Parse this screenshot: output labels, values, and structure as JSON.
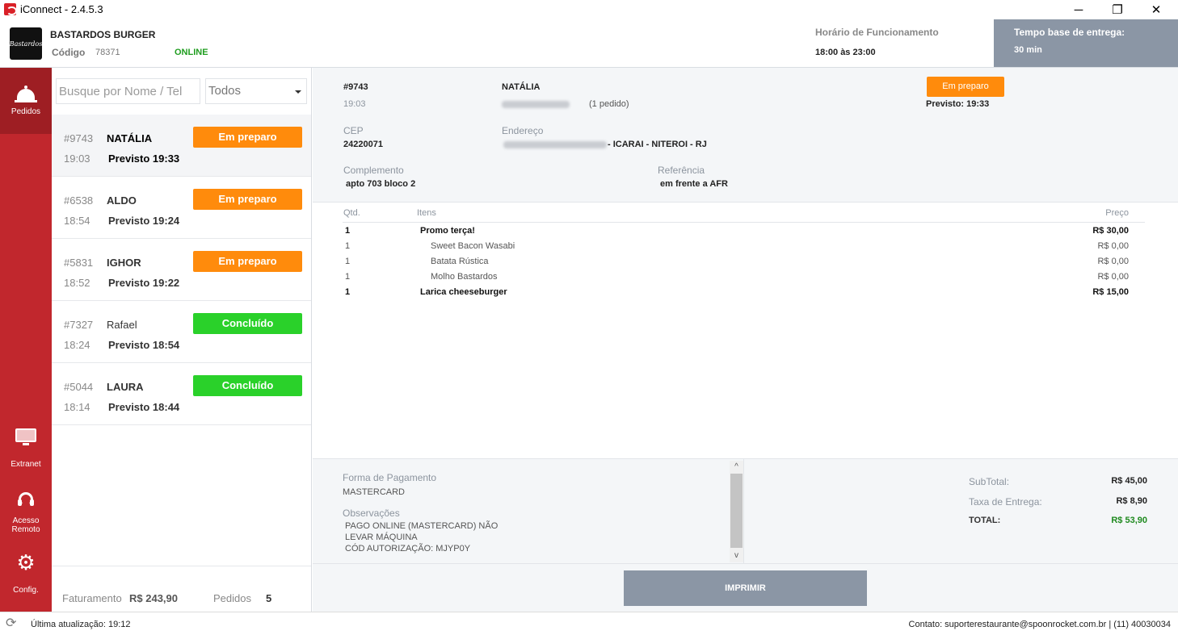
{
  "window": {
    "title": "iConnect - 2.4.5.3",
    "minimize_glyph": "─",
    "maximize_glyph": "❐",
    "close_glyph": "✕"
  },
  "header": {
    "store_name": "BASTARDOS BURGER",
    "code_label": "Código",
    "code_value": "78371",
    "status": "ONLINE",
    "hours_label": "Horário de Funcionamento",
    "hours_value": "18:00 às 23:00",
    "delivery_label": "Tempo base de entrega:",
    "delivery_value": "30 min"
  },
  "sidebar": {
    "items": [
      {
        "label": "Pedidos",
        "icon": "bell-icon"
      },
      {
        "label": "Extranet",
        "icon": "monitor-icon"
      },
      {
        "label": "Acesso Remoto",
        "icon": "headset-icon"
      },
      {
        "label": "Config.",
        "icon": "gear-icon"
      }
    ]
  },
  "list": {
    "search_placeholder": "Busque por Nome / Tel",
    "filter_value": "Todos",
    "orders": [
      {
        "id": "#9743",
        "name": "NATÁLIA",
        "time": "19:03",
        "eta": "Previsto 19:33",
        "status": "Em preparo"
      },
      {
        "id": "#6538",
        "name": "ALDO",
        "time": "18:54",
        "eta": "Previsto 19:24",
        "status": "Em preparo"
      },
      {
        "id": "#5831",
        "name": "IGHOR",
        "time": "18:52",
        "eta": "Previsto 19:22",
        "status": "Em preparo"
      },
      {
        "id": "#7327",
        "name": "Rafael",
        "time": "18:24",
        "eta": "Previsto 18:54",
        "status": "Concluído"
      },
      {
        "id": "#5044",
        "name": "LAURA",
        "time": "18:14",
        "eta": "Previsto 18:44",
        "status": "Concluído"
      }
    ],
    "footer": {
      "billing_label": "Faturamento",
      "billing_value": "R$ 243,90",
      "count_label": "Pedidos",
      "count_value": "5"
    }
  },
  "detail": {
    "order_id": "#9743",
    "time": "19:03",
    "customer": "NATÁLIA",
    "orders_count": "(1 pedido)",
    "status": "Em preparo",
    "eta": "Previsto: 19:33",
    "cep_label": "CEP",
    "cep_value": "24220071",
    "address_label": "Endereço",
    "address_suffix": "- ICARAI - NITEROI - RJ",
    "complement_label": "Complemento",
    "complement_value": "apto 703 bloco 2",
    "reference_label": "Referência",
    "reference_value": "em frente a AFR",
    "table_headers": {
      "qty": "Qtd.",
      "items": "Itens",
      "price": "Preço"
    },
    "items": [
      {
        "qty": "1",
        "name": "Promo terça!",
        "price": "R$ 30,00",
        "main": true
      },
      {
        "qty": "1",
        "name": "Sweet Bacon Wasabi",
        "price": "R$ 0,00",
        "main": false
      },
      {
        "qty": "1",
        "name": "Batata Rústica",
        "price": "R$ 0,00",
        "main": false
      },
      {
        "qty": "1",
        "name": "Molho Bastardos",
        "price": "R$ 0,00",
        "main": false
      },
      {
        "qty": "1",
        "name": "Larica cheeseburger",
        "price": "R$ 15,00",
        "main": true
      }
    ],
    "payment_label": "Forma de Pagamento",
    "payment_value": "MASTERCARD",
    "notes_label": "Observações",
    "notes_lines": [
      "PAGO ONLINE (MASTERCARD) NÃO",
      "LEVAR MÁQUINA",
      "CÓD AUTORIZAÇÃO: MJYP0Y"
    ],
    "subtotal_label": "SubTotal:",
    "subtotal_value": "R$ 45,00",
    "fee_label": "Taxa de Entrega:",
    "fee_value": "R$ 8,90",
    "total_label": "TOTAL:",
    "total_value": "R$ 53,90",
    "print_label": "IMPRIMIR",
    "scroll_up_glyph": "^",
    "scroll_down_glyph": "v"
  },
  "statusbar": {
    "refresh_glyph": "⟳",
    "last_update": "Última atualização: 19:12",
    "contact": "Contato: suporterestaurante@spoonrocket.com.br | (11) 40030034"
  },
  "colors": {
    "sidebar": "#c1272d",
    "status_orange": "#ff8b0c",
    "status_green": "#2ad12a",
    "accent_gray": "#8b96a5",
    "online_green": "#1f9d1f"
  }
}
